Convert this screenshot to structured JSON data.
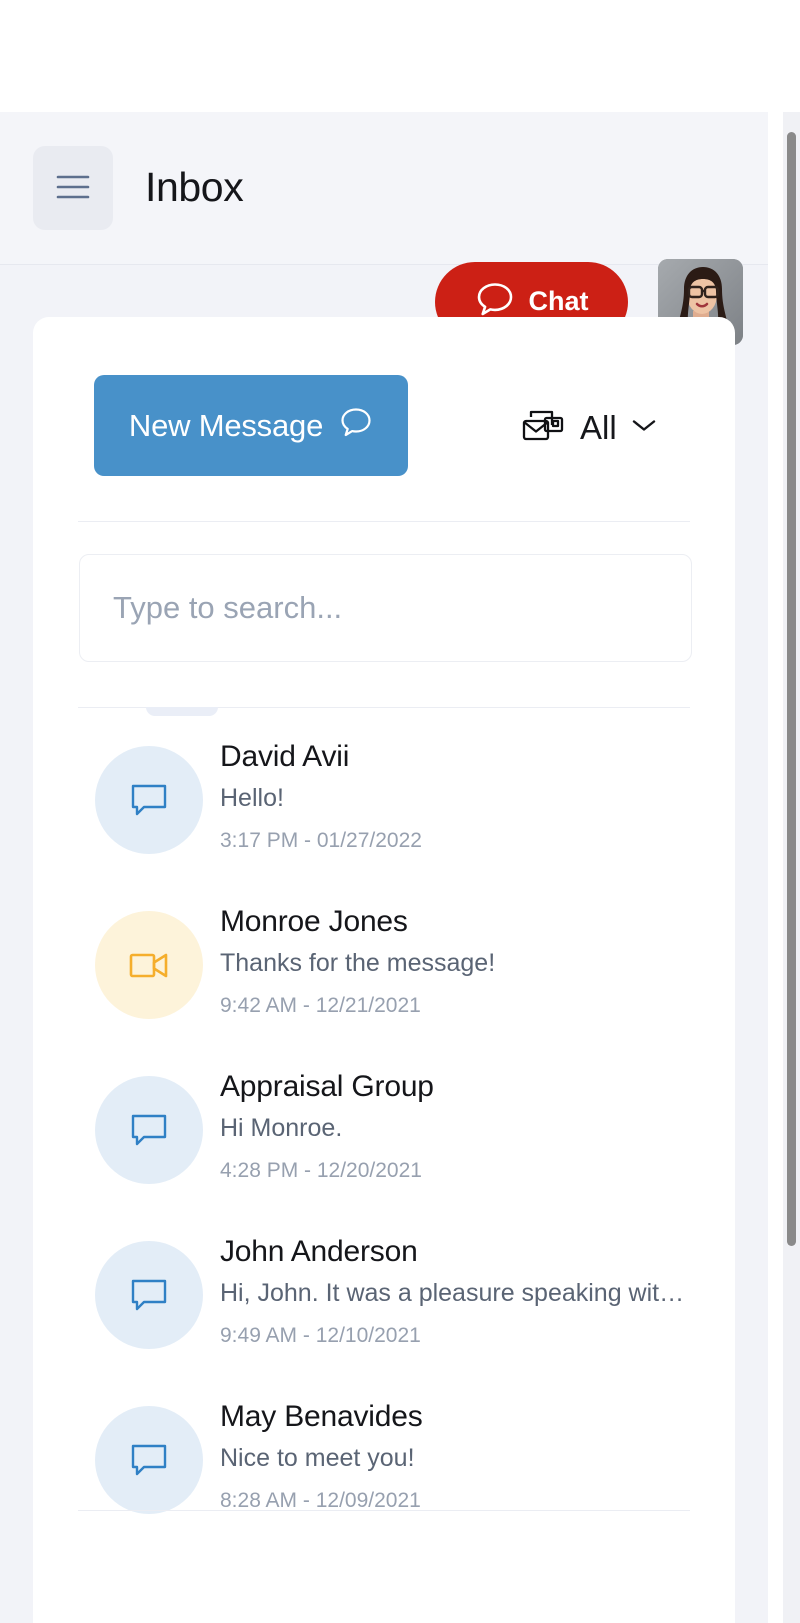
{
  "header": {
    "title": "Inbox",
    "menu_icon": "hamburger-menu-icon",
    "chat_button": {
      "label": "Chat",
      "icon": "speech-bubble-icon",
      "color": "#cc2015"
    },
    "avatar": {
      "icon": "user-avatar-photo",
      "alt": "Profile photo"
    }
  },
  "toolbar": {
    "new_message": {
      "label": "New Message",
      "icon": "speech-bubble-icon",
      "color": "#4891c9"
    },
    "filter": {
      "label": "All",
      "icon": "mail-stack-icon",
      "chevron": "chevron-down-icon"
    }
  },
  "search": {
    "value": "",
    "placeholder": "Type to search..."
  },
  "messages": [
    {
      "name": "David Avii",
      "preview": "Hello!",
      "time": "3:17 PM - 01/27/2022",
      "icon": "message-bubble-icon",
      "icon_style": "blue"
    },
    {
      "name": "Monroe Jones",
      "preview": "Thanks for the message!",
      "time": "9:42 AM - 12/21/2021",
      "icon": "video-camera-icon",
      "icon_style": "yellow"
    },
    {
      "name": "Appraisal Group",
      "preview": "Hi Monroe.",
      "time": "4:28 PM - 12/20/2021",
      "icon": "message-bubble-icon",
      "icon_style": "blue"
    },
    {
      "name": "John Anderson",
      "preview": "Hi, John. It was a pleasure speaking with you y…",
      "time": "9:49 AM - 12/10/2021",
      "icon": "message-bubble-icon",
      "icon_style": "blue"
    },
    {
      "name": "May Benavides",
      "preview": "Nice to meet you!",
      "time": "8:28 AM - 12/09/2021",
      "icon": "message-bubble-icon",
      "icon_style": "blue"
    }
  ],
  "colors": {
    "accent_red": "#cc2015",
    "accent_blue": "#4891c9",
    "icon_blue": "#2f80c5",
    "icon_yellow": "#f5ae2c",
    "page_bg": "#f2f3f8",
    "card_bg": "#ffffff"
  }
}
